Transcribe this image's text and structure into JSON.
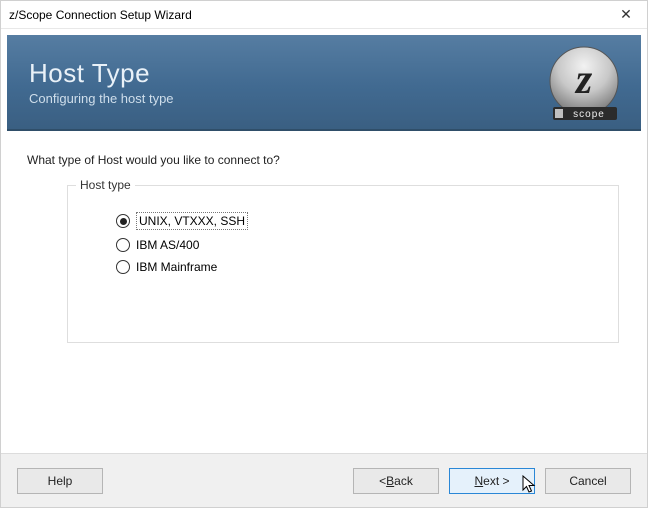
{
  "window": {
    "title": "z/Scope Connection Setup Wizard"
  },
  "banner": {
    "title": "Host Type",
    "subtitle": "Configuring the host type",
    "logo_text": "z",
    "logo_caption": "scope"
  },
  "content": {
    "question": "What type of Host would you like to connect to?",
    "fieldset_legend": "Host type",
    "options": [
      {
        "label": "UNIX, VTXXX, SSH",
        "selected": true
      },
      {
        "label": "IBM AS/400",
        "selected": false
      },
      {
        "label": "IBM Mainframe",
        "selected": false
      }
    ]
  },
  "footer": {
    "help": "Help",
    "back_prefix": "< ",
    "back_mn": "B",
    "back_rest": "ack",
    "next_mn": "N",
    "next_rest": "ext >",
    "cancel": "Cancel"
  }
}
